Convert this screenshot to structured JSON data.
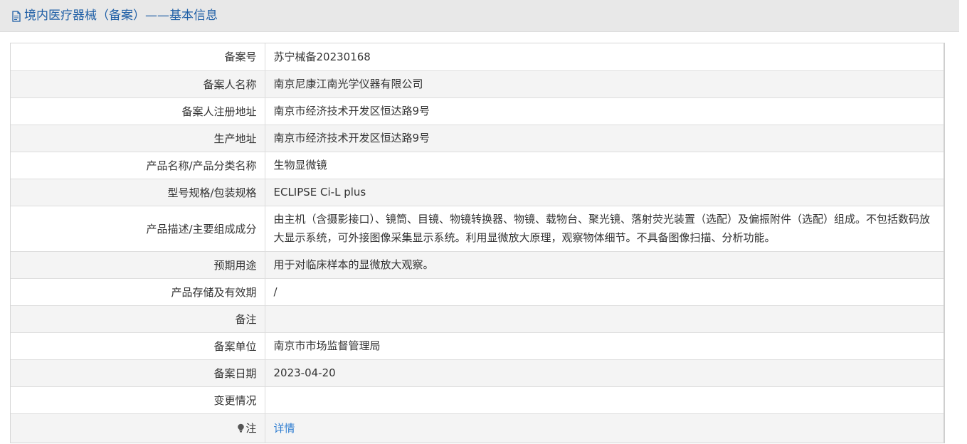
{
  "header": {
    "icon": "document-icon",
    "title": "境内医疗器械（备案）——基本信息"
  },
  "rows": [
    {
      "label": "备案号",
      "value": "苏宁械备20230168"
    },
    {
      "label": "备案人名称",
      "value": "南京尼康江南光学仪器有限公司"
    },
    {
      "label": "备案人注册地址",
      "value": "南京市经济技术开发区恒达路9号"
    },
    {
      "label": "生产地址",
      "value": "南京市经济技术开发区恒达路9号"
    },
    {
      "label": "产品名称/产品分类名称",
      "value": "生物显微镜"
    },
    {
      "label": "型号规格/包装规格",
      "value": "ECLIPSE Ci-L plus"
    },
    {
      "label": "产品描述/主要组成成分",
      "value": "由主机（含摄影接口）、镜筒、目镜、物镜转换器、物镜、载物台、聚光镜、落射荧光装置（选配）及偏振附件（选配）组成。不包括数码放大显示系统，可外接图像采集显示系统。利用显微放大原理，观察物体细节。不具备图像扫描、分析功能。"
    },
    {
      "label": "预期用途",
      "value": "用于对临床样本的显微放大观察。"
    },
    {
      "label": "产品存储及有效期",
      "value": "/"
    },
    {
      "label": "备注",
      "value": ""
    },
    {
      "label": "备案单位",
      "value": "南京市市场监督管理局"
    },
    {
      "label": "备案日期",
      "value": "2023-04-20"
    },
    {
      "label": "变更情况",
      "value": ""
    }
  ],
  "note": {
    "icon": "lightbulb-icon",
    "label": "注",
    "link_text": "详情"
  },
  "colors": {
    "header_bg": "#e8e8e8",
    "title": "#1f5fa6",
    "link": "#2e7dd1",
    "stripe": "#f4f4f4"
  }
}
